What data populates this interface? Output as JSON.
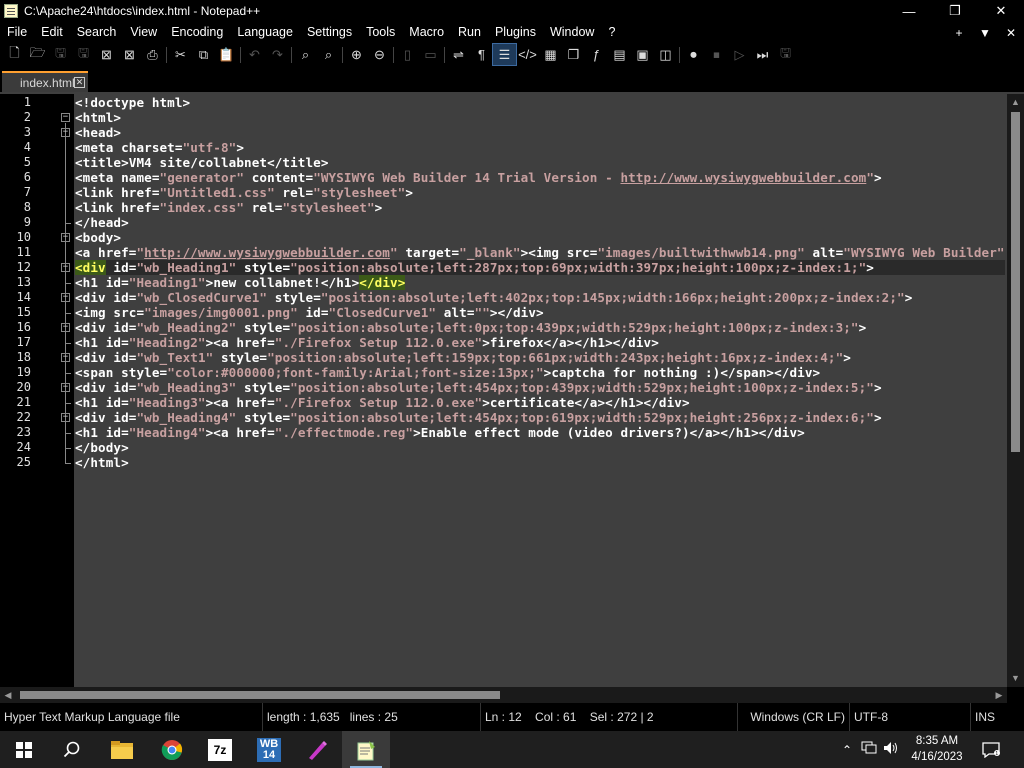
{
  "window": {
    "title": "C:\\Apache24\\htdocs\\index.html - Notepad++",
    "minimize": "—",
    "maximize": "❐",
    "close": "✕"
  },
  "menu": {
    "items": [
      "File",
      "Edit",
      "Search",
      "View",
      "Encoding",
      "Language",
      "Settings",
      "Tools",
      "Macro",
      "Run",
      "Plugins",
      "Window",
      "?"
    ],
    "right": [
      "+",
      "▼",
      "✕"
    ]
  },
  "toolbar": {
    "icons": [
      "new-file-icon",
      "open-file-icon",
      "save-icon",
      "save-all-icon",
      "close-icon",
      "close-all-icon",
      "print-icon",
      "cut-icon",
      "copy-icon",
      "paste-icon",
      "undo-icon",
      "redo-icon",
      "find-icon",
      "replace-icon",
      "zoom-in-icon",
      "zoom-out-icon",
      "sync-vertical-icon",
      "sync-horizontal-icon",
      "word-wrap-icon",
      "show-all-characters-icon",
      "indent-guide-icon",
      "xml-tag-icon",
      "document-map-icon",
      "document-list-icon",
      "function-list-icon",
      "folder-as-workspace-icon",
      "monitoring-icon",
      "record-macro-icon",
      "stop-macro-icon",
      "play-macro-icon",
      "run-macro-multiple-icon",
      "save-macro-icon"
    ]
  },
  "tabs": [
    {
      "label": "index.html",
      "close": "✕"
    }
  ],
  "editor": {
    "current_line": 12,
    "lines": [
      [
        [
          "t-tag",
          "<!doctype html>"
        ]
      ],
      [
        [
          "t-tag",
          "<html>"
        ]
      ],
      [
        [
          "t-tag",
          "<head>"
        ]
      ],
      [
        [
          "t-tag",
          "<meta "
        ],
        [
          "t-attr",
          "charset"
        ],
        [
          "t-tag",
          "="
        ],
        [
          "t-val",
          "\"utf-8\""
        ],
        [
          "t-tag",
          ">"
        ]
      ],
      [
        [
          "t-tag",
          "<title>"
        ],
        [
          "t-text",
          "VM4 site/collabnet"
        ],
        [
          "t-tag",
          "</title>"
        ]
      ],
      [
        [
          "t-tag",
          "<meta "
        ],
        [
          "t-attr",
          "name"
        ],
        [
          "t-tag",
          "="
        ],
        [
          "t-val",
          "\"generator\""
        ],
        [
          "t-attr",
          " content"
        ],
        [
          "t-tag",
          "="
        ],
        [
          "t-val",
          "\"WYSIWYG Web Builder 14 Trial Version - "
        ],
        [
          "t-link",
          "http://www.wysiwygwebbuilder.com"
        ],
        [
          "t-val",
          "\""
        ],
        [
          "t-tag",
          ">"
        ]
      ],
      [
        [
          "t-tag",
          "<link "
        ],
        [
          "t-attr",
          "href"
        ],
        [
          "t-tag",
          "="
        ],
        [
          "t-val",
          "\"Untitled1.css\""
        ],
        [
          "t-attr",
          " rel"
        ],
        [
          "t-tag",
          "="
        ],
        [
          "t-val",
          "\"stylesheet\""
        ],
        [
          "t-tag",
          ">"
        ]
      ],
      [
        [
          "t-tag",
          "<link "
        ],
        [
          "t-attr",
          "href"
        ],
        [
          "t-tag",
          "="
        ],
        [
          "t-val",
          "\"index.css\""
        ],
        [
          "t-attr",
          " rel"
        ],
        [
          "t-tag",
          "="
        ],
        [
          "t-val",
          "\"stylesheet\""
        ],
        [
          "t-tag",
          ">"
        ]
      ],
      [
        [
          "t-tag",
          "</head>"
        ]
      ],
      [
        [
          "t-tag",
          "<body>"
        ]
      ],
      [
        [
          "t-tag",
          "<a "
        ],
        [
          "t-attr",
          "href"
        ],
        [
          "t-tag",
          "="
        ],
        [
          "t-val",
          "\""
        ],
        [
          "t-link",
          "http://www.wysiwygwebbuilder.com"
        ],
        [
          "t-val",
          "\""
        ],
        [
          "t-attr",
          " target"
        ],
        [
          "t-tag",
          "="
        ],
        [
          "t-val",
          "\"_blank\""
        ],
        [
          "t-tag",
          "><img "
        ],
        [
          "t-attr",
          "src"
        ],
        [
          "t-tag",
          "="
        ],
        [
          "t-val",
          "\"images/builtwithwwb14.png\""
        ],
        [
          "t-attr",
          " alt"
        ],
        [
          "t-tag",
          "="
        ],
        [
          "t-val",
          "\"WYSIWYG Web Builder\""
        ]
      ],
      [
        [
          "t-hl",
          "<div"
        ],
        [
          "t-attr",
          " id"
        ],
        [
          "t-tag",
          "="
        ],
        [
          "t-val",
          "\"wb_Heading1\""
        ],
        [
          "t-attr",
          " style"
        ],
        [
          "t-tag",
          "="
        ],
        [
          "t-val",
          "\"position:absolute;left:287px;top:69px;width:397px;height:100px;z-index:1;\""
        ],
        [
          "t-tag",
          ">"
        ]
      ],
      [
        [
          "t-tag",
          "<h1 "
        ],
        [
          "t-attr",
          "id"
        ],
        [
          "t-tag",
          "="
        ],
        [
          "t-val",
          "\"Heading1\""
        ],
        [
          "t-tag",
          ">"
        ],
        [
          "t-text",
          "new collabnet!"
        ],
        [
          "t-tag",
          "</h1>"
        ],
        [
          "t-hl",
          "</div>"
        ]
      ],
      [
        [
          "t-tag",
          "<div "
        ],
        [
          "t-attr",
          "id"
        ],
        [
          "t-tag",
          "="
        ],
        [
          "t-val",
          "\"wb_ClosedCurve1\""
        ],
        [
          "t-attr",
          " style"
        ],
        [
          "t-tag",
          "="
        ],
        [
          "t-val",
          "\"position:absolute;left:402px;top:145px;width:166px;height:200px;z-index:2;\""
        ],
        [
          "t-tag",
          ">"
        ]
      ],
      [
        [
          "t-tag",
          "<img "
        ],
        [
          "t-attr",
          "src"
        ],
        [
          "t-tag",
          "="
        ],
        [
          "t-val",
          "\"images/img0001.png\""
        ],
        [
          "t-attr",
          " id"
        ],
        [
          "t-tag",
          "="
        ],
        [
          "t-val",
          "\"ClosedCurve1\""
        ],
        [
          "t-attr",
          " alt"
        ],
        [
          "t-tag",
          "="
        ],
        [
          "t-val",
          "\"\""
        ],
        [
          "t-tag",
          "></div>"
        ]
      ],
      [
        [
          "t-tag",
          "<div "
        ],
        [
          "t-attr",
          "id"
        ],
        [
          "t-tag",
          "="
        ],
        [
          "t-val",
          "\"wb_Heading2\""
        ],
        [
          "t-attr",
          " style"
        ],
        [
          "t-tag",
          "="
        ],
        [
          "t-val",
          "\"position:absolute;left:0px;top:439px;width:529px;height:100px;z-index:3;\""
        ],
        [
          "t-tag",
          ">"
        ]
      ],
      [
        [
          "t-tag",
          "<h1 "
        ],
        [
          "t-attr",
          "id"
        ],
        [
          "t-tag",
          "="
        ],
        [
          "t-val",
          "\"Heading2\""
        ],
        [
          "t-tag",
          "><a "
        ],
        [
          "t-attr",
          "href"
        ],
        [
          "t-tag",
          "="
        ],
        [
          "t-val",
          "\"./Firefox Setup 112.0.exe\""
        ],
        [
          "t-tag",
          ">"
        ],
        [
          "t-text",
          "firefox"
        ],
        [
          "t-tag",
          "</a></h1></div>"
        ]
      ],
      [
        [
          "t-tag",
          "<div "
        ],
        [
          "t-attr",
          "id"
        ],
        [
          "t-tag",
          "="
        ],
        [
          "t-val",
          "\"wb_Text1\""
        ],
        [
          "t-attr",
          " style"
        ],
        [
          "t-tag",
          "="
        ],
        [
          "t-val",
          "\"position:absolute;left:159px;top:661px;width:243px;height:16px;z-index:4;\""
        ],
        [
          "t-tag",
          ">"
        ]
      ],
      [
        [
          "t-tag",
          "<span "
        ],
        [
          "t-attr",
          "style"
        ],
        [
          "t-tag",
          "="
        ],
        [
          "t-val",
          "\"color:#000000;font-family:Arial;font-size:13px;\""
        ],
        [
          "t-tag",
          ">"
        ],
        [
          "t-text",
          "captcha for nothing :)"
        ],
        [
          "t-tag",
          "</span></div>"
        ]
      ],
      [
        [
          "t-tag",
          "<div "
        ],
        [
          "t-attr",
          "id"
        ],
        [
          "t-tag",
          "="
        ],
        [
          "t-val",
          "\"wb_Heading3\""
        ],
        [
          "t-attr",
          " style"
        ],
        [
          "t-tag",
          "="
        ],
        [
          "t-val",
          "\"position:absolute;left:454px;top:439px;width:529px;height:100px;z-index:5;\""
        ],
        [
          "t-tag",
          ">"
        ]
      ],
      [
        [
          "t-tag",
          "<h1 "
        ],
        [
          "t-attr",
          "id"
        ],
        [
          "t-tag",
          "="
        ],
        [
          "t-val",
          "\"Heading3\""
        ],
        [
          "t-tag",
          "><a "
        ],
        [
          "t-attr",
          "href"
        ],
        [
          "t-tag",
          "="
        ],
        [
          "t-val",
          "\"./Firefox Setup 112.0.exe\""
        ],
        [
          "t-tag",
          ">"
        ],
        [
          "t-text",
          "certificate"
        ],
        [
          "t-tag",
          "</a></h1></div>"
        ]
      ],
      [
        [
          "t-tag",
          "<div "
        ],
        [
          "t-attr",
          "id"
        ],
        [
          "t-tag",
          "="
        ],
        [
          "t-val",
          "\"wb_Heading4\""
        ],
        [
          "t-attr",
          " style"
        ],
        [
          "t-tag",
          "="
        ],
        [
          "t-val",
          "\"position:absolute;left:454px;top:619px;width:529px;height:256px;z-index:6;\""
        ],
        [
          "t-tag",
          ">"
        ]
      ],
      [
        [
          "t-tag",
          "<h1 "
        ],
        [
          "t-attr",
          "id"
        ],
        [
          "t-tag",
          "="
        ],
        [
          "t-val",
          "\"Heading4\""
        ],
        [
          "t-tag",
          "><a "
        ],
        [
          "t-attr",
          "href"
        ],
        [
          "t-tag",
          "="
        ],
        [
          "t-val",
          "\"./effectmode.reg\""
        ],
        [
          "t-tag",
          ">"
        ],
        [
          "t-text",
          "Enable effect mode (video drivers?)"
        ],
        [
          "t-tag",
          "</a></h1></div>"
        ]
      ],
      [
        [
          "t-tag",
          "</body>"
        ]
      ],
      [
        [
          "t-tag",
          "</html>"
        ]
      ]
    ]
  },
  "statusbar": {
    "file_type": "Hyper Text Markup Language file",
    "length": "length : 1,635",
    "lines": "lines : 25",
    "ln": "Ln : 12",
    "col": "Col : 61",
    "sel": "Sel : 272 | 2",
    "eol": "Windows (CR LF)",
    "encoding": "UTF-8",
    "mode": "INS"
  },
  "taskbar": {
    "apps": [
      "windows-start-icon",
      "search-icon",
      "file-explorer-icon",
      "chrome-icon",
      "7zip-icon",
      "wysiwyg-web-builder-icon",
      "pen-tool-icon",
      "notepad-plus-plus-icon"
    ],
    "tray": {
      "chevron": "⌃"
    },
    "time": "8:35 AM",
    "date": "4/16/2023"
  },
  "colors": {
    "accent_tab": "#ffa030",
    "editor_bg": "#3f3f3f",
    "attr_value": "#c8a0a0",
    "highlight_tag": "#ffff60"
  }
}
